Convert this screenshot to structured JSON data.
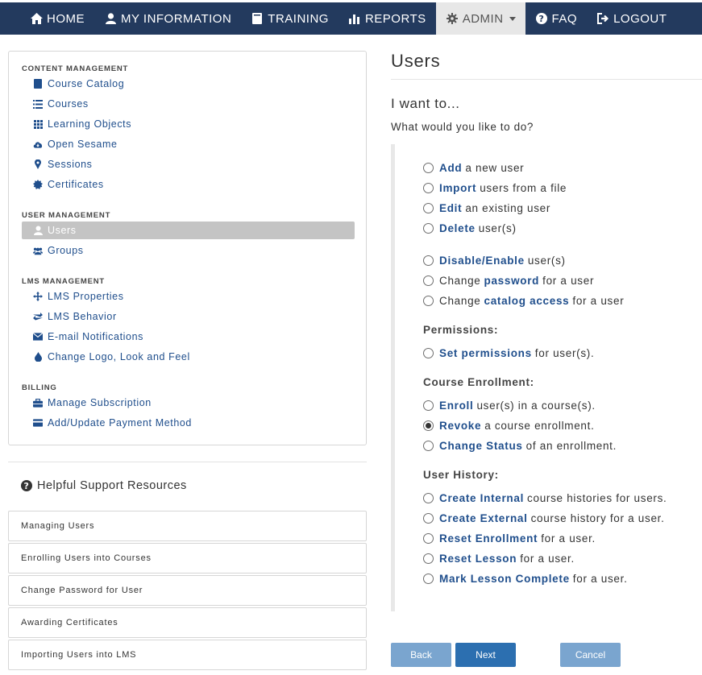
{
  "nav": {
    "home": "HOME",
    "my_information": "MY INFORMATION",
    "training": "TRAINING",
    "reports": "REPORTS",
    "admin": "ADMIN",
    "faq": "FAQ",
    "logout": "LOGOUT"
  },
  "sidebar": {
    "content_management": {
      "heading": "CONTENT MANAGEMENT",
      "items": [
        "Course Catalog",
        "Courses",
        "Learning Objects",
        "Open Sesame",
        "Sessions",
        "Certificates"
      ]
    },
    "user_management": {
      "heading": "USER MANAGEMENT",
      "items": [
        "Users",
        "Groups"
      ]
    },
    "lms_management": {
      "heading": "LMS MANAGEMENT",
      "items": [
        "LMS Properties",
        "LMS Behavior",
        "E-mail Notifications",
        "Change Logo, Look and Feel"
      ]
    },
    "billing": {
      "heading": "BILLING",
      "items": [
        "Manage Subscription",
        "Add/Update Payment Method"
      ]
    }
  },
  "support": {
    "title": "Helpful Support Resources",
    "items": [
      "Managing Users",
      "Enrolling Users into Courses",
      "Change Password for User",
      "Awarding Certificates",
      "Importing Users into LMS"
    ]
  },
  "main": {
    "page_title": "Users",
    "want_title": "I want to...",
    "want_subtitle": "What would you like to do?",
    "options": {
      "add": {
        "pre": "",
        "key": "Add",
        "post": "a new user"
      },
      "import": {
        "pre": "",
        "key": "Import",
        "post": "users from a file"
      },
      "edit": {
        "pre": "",
        "key": "Edit",
        "post": "an existing user"
      },
      "delete": {
        "pre": "",
        "key": "Delete",
        "post": "user(s)"
      },
      "disable": {
        "pre": "",
        "key": "Disable/Enable",
        "post": "user(s)"
      },
      "password": {
        "pre": "Change",
        "key": "password",
        "post": "for a user"
      },
      "catalog": {
        "pre": "Change",
        "key": "catalog access",
        "post": "for a user"
      },
      "permissions": {
        "pre": "",
        "key": "Set permissions",
        "post": "for user(s)."
      },
      "enroll": {
        "pre": "",
        "key": "Enroll",
        "post": "user(s) in a course(s)."
      },
      "revoke": {
        "pre": "",
        "key": "Revoke",
        "post": "a course enrollment."
      },
      "change_status": {
        "pre": "",
        "key": "Change Status",
        "post": "of an enrollment."
      },
      "create_internal": {
        "pre": "",
        "key": "Create Internal",
        "post": "course histories for users."
      },
      "create_external": {
        "pre": "",
        "key": "Create External",
        "post": "course history for a user."
      },
      "reset_enrollment": {
        "pre": "",
        "key": "Reset Enrollment",
        "post": "for a user."
      },
      "reset_lesson": {
        "pre": "",
        "key": "Reset Lesson",
        "post": "for a user."
      },
      "mark_complete": {
        "pre": "",
        "key": "Mark Lesson Complete",
        "post": "for a user."
      }
    },
    "groups": {
      "permissions": "Permissions:",
      "course_enrollment": "Course Enrollment:",
      "user_history": "User History:"
    },
    "selected_option": "revoke"
  },
  "buttons": {
    "back": "Back",
    "next": "Next",
    "cancel": "Cancel"
  }
}
